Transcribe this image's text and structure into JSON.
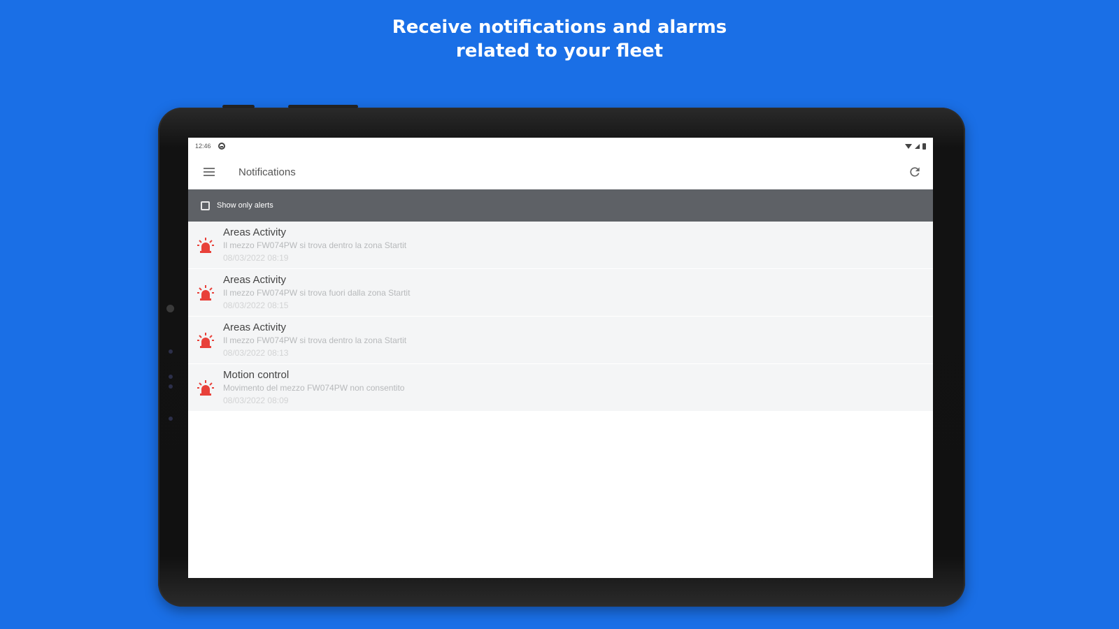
{
  "headline": {
    "line1": "Receive notifications and alarms",
    "line2": "related to your fleet"
  },
  "statusbar": {
    "time": "12:46"
  },
  "appbar": {
    "title": "Notifications",
    "menu_icon": "hamburger-menu-icon",
    "refresh_icon": "refresh-icon"
  },
  "filter": {
    "label": "Show only alerts",
    "checked": false
  },
  "notifications": [
    {
      "title": "Areas Activity",
      "body": "Il mezzo FW074PW si trova dentro la zona Startit",
      "date": "08/03/2022 08:19"
    },
    {
      "title": "Areas Activity",
      "body": "Il mezzo FW074PW si trova fuori dalla zona Startit",
      "date": "08/03/2022 08:15"
    },
    {
      "title": "Areas Activity",
      "body": "Il mezzo FW074PW si trova dentro la zona Startit",
      "date": "08/03/2022 08:13"
    },
    {
      "title": "Motion control",
      "body": "Movimento del mezzo FW074PW non consentito",
      "date": "08/03/2022 08:09"
    }
  ],
  "colors": {
    "background": "#1a6fe6",
    "filterbar": "#5e6166",
    "alarm": "#e8413a"
  }
}
